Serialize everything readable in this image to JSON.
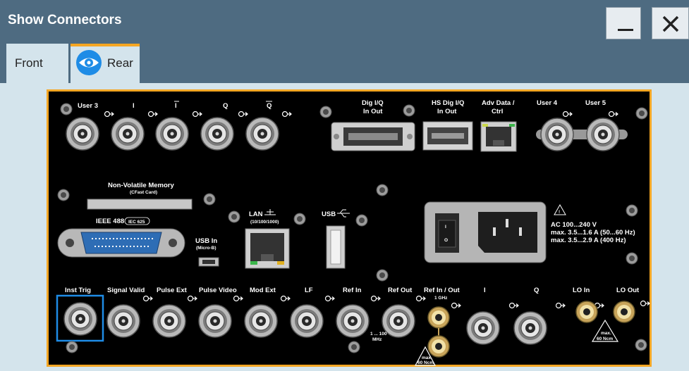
{
  "window": {
    "title": "Show Connectors"
  },
  "tabs": [
    {
      "label": "Front",
      "active": false
    },
    {
      "label": "Rear",
      "active": true,
      "icon": "eye-icon"
    }
  ],
  "colors": {
    "titlebar": "#4e6b81",
    "content_bg": "#d4e4ec",
    "accent": "#f5a623",
    "highlight": "#1e8ce6"
  },
  "panel": {
    "top_labels": {
      "user3": "User 3",
      "i": "I",
      "ibar": "I",
      "q": "Q",
      "qbar": "Q",
      "dig_iq": "Dig I/Q",
      "dig_iq_sub": "In Out",
      "hs_dig_iq": "HS Dig I/Q",
      "hs_dig_iq_sub": "In Out",
      "adv_data": "Adv Data /",
      "adv_data_sub": "Ctrl",
      "user4": "User 4",
      "user5": "User 5"
    },
    "memory": {
      "label": "Non-Volatile Memory",
      "sub": "(CFast Card)"
    },
    "ieee": {
      "label": "IEEE 488",
      "badge": "IEC 625"
    },
    "usb_in": {
      "label": "USB In",
      "sub": "(Micro-B)"
    },
    "lan": {
      "label": "LAN",
      "sub": "(10/100/1000)"
    },
    "usb": {
      "label": "USB"
    },
    "power": {
      "line1": "AC 100...240 V",
      "line2": "max. 3.5...1.6 A (50...60 Hz)",
      "line3": "max. 3.5...2.9 A (400 Hz)",
      "switch_on": "I",
      "switch_off": "O"
    },
    "bottom_labels": {
      "inst_trig": "Inst Trig",
      "signal_valid": "Signal Valid",
      "pulse_ext": "Pulse Ext",
      "pulse_video": "Pulse Video",
      "mod_ext": "Mod Ext",
      "lf": "LF",
      "ref_in": "Ref In",
      "ref_out": "Ref Out",
      "ref_in_out": "Ref In / Out",
      "ref_in_out_sub": "1 GHz",
      "i": "I",
      "q": "Q",
      "lo_in": "LO In",
      "lo_out": "LO Out",
      "ref_freq": "1 ... 100",
      "ref_freq_unit": "MHz"
    },
    "warnings": {
      "max": "max.",
      "torque": "60 Ncm"
    }
  }
}
